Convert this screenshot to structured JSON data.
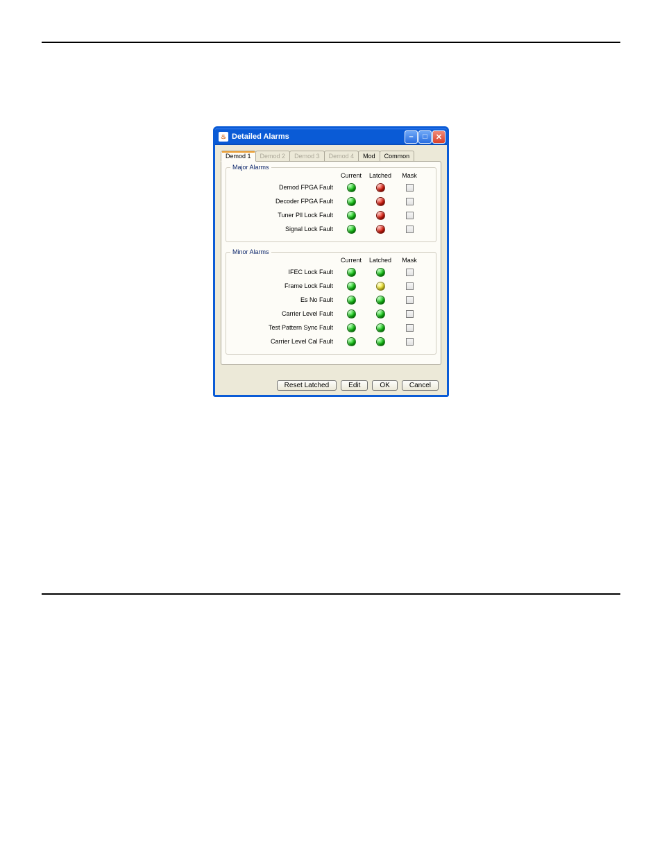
{
  "dialog": {
    "title": "Detailed Alarms",
    "tabs": [
      "Demod 1",
      "Demod 2",
      "Demod 3",
      "Demod 4",
      "Mod",
      "Common"
    ],
    "activeTab": 0,
    "headers": {
      "current": "Current",
      "latched": "Latched",
      "mask": "Mask"
    },
    "majorGroup": {
      "title": "Major Alarms",
      "rows": [
        {
          "label": "Demod FPGA Fault",
          "current": "green",
          "latched": "red"
        },
        {
          "label": "Decoder FPGA Fault",
          "current": "green",
          "latched": "red"
        },
        {
          "label": "Tuner Pll Lock Fault",
          "current": "green",
          "latched": "red"
        },
        {
          "label": "Signal Lock Fault",
          "current": "green",
          "latched": "red"
        }
      ]
    },
    "minorGroup": {
      "title": "Minor Alarms",
      "rows": [
        {
          "label": "IFEC Lock Fault",
          "current": "green",
          "latched": "green"
        },
        {
          "label": "Frame Lock Fault",
          "current": "green",
          "latched": "yellow"
        },
        {
          "label": "Es No Fault",
          "current": "green",
          "latched": "green"
        },
        {
          "label": "Carrier Level Fault",
          "current": "green",
          "latched": "green"
        },
        {
          "label": "Test Pattern Sync Fault",
          "current": "green",
          "latched": "green"
        },
        {
          "label": "Carrier Level Cal Fault",
          "current": "green",
          "latched": "green"
        }
      ]
    },
    "buttons": {
      "reset": "Reset Latched",
      "edit": "Edit",
      "ok": "OK",
      "cancel": "Cancel"
    }
  }
}
